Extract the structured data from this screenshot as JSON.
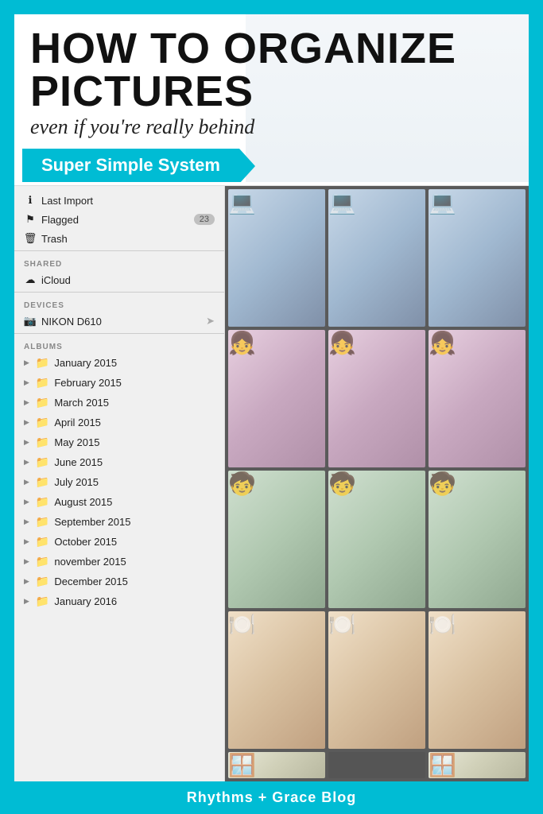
{
  "header": {
    "title_line1": "HOW TO ORGANIZE",
    "title_line2": "PICTURES",
    "subtitle": "even if you're really behind",
    "banner": "Super Simple System"
  },
  "sidebar": {
    "items_top": [
      {
        "id": "last-import",
        "icon": "ℹ",
        "label": "Last Import",
        "badge": null
      },
      {
        "id": "flagged",
        "icon": "⚑",
        "label": "Flagged",
        "badge": "23"
      },
      {
        "id": "trash",
        "icon": "🗑",
        "label": "Trash",
        "badge": null
      }
    ],
    "sections": [
      {
        "label": "SHARED",
        "items": [
          {
            "id": "icloud",
            "icon": "☁",
            "label": "iCloud"
          }
        ]
      },
      {
        "label": "DEVICES",
        "items": [
          {
            "id": "nikon",
            "icon": "📷",
            "label": "NIKON D610",
            "has_arrow": true
          }
        ]
      },
      {
        "label": "ALBUMS",
        "items": [
          {
            "id": "jan2015",
            "label": "January 2015"
          },
          {
            "id": "feb2015",
            "label": "February 2015"
          },
          {
            "id": "mar2015",
            "label": "March 2015"
          },
          {
            "id": "apr2015",
            "label": "April 2015"
          },
          {
            "id": "may2015",
            "label": "May 2015"
          },
          {
            "id": "jun2015",
            "label": "June 2015"
          },
          {
            "id": "jul2015",
            "label": "July 2015"
          },
          {
            "id": "aug2015",
            "label": "August 2015"
          },
          {
            "id": "sep2015",
            "label": "September 2015"
          },
          {
            "id": "oct2015",
            "label": "October 2015"
          },
          {
            "id": "nov2015",
            "label": "november 2015"
          },
          {
            "id": "dec2015",
            "label": "December 2015"
          },
          {
            "id": "jan2016",
            "label": "January 2016"
          }
        ]
      }
    ]
  },
  "photos": {
    "rows": [
      [
        "laptop",
        "laptop",
        "laptop"
      ],
      [
        "child-purple",
        "child-purple",
        "child-purple"
      ],
      [
        "child-color",
        "child-color",
        "child-color"
      ],
      [
        "kitchen",
        "kitchen",
        "kitchen"
      ],
      [
        "window",
        "empty",
        "window"
      ]
    ]
  },
  "footer": {
    "label": "Rhythms + Grace Blog"
  },
  "colors": {
    "teal": "#00bcd4",
    "text_dark": "#111111",
    "sidebar_bg": "#f0f0f0"
  }
}
